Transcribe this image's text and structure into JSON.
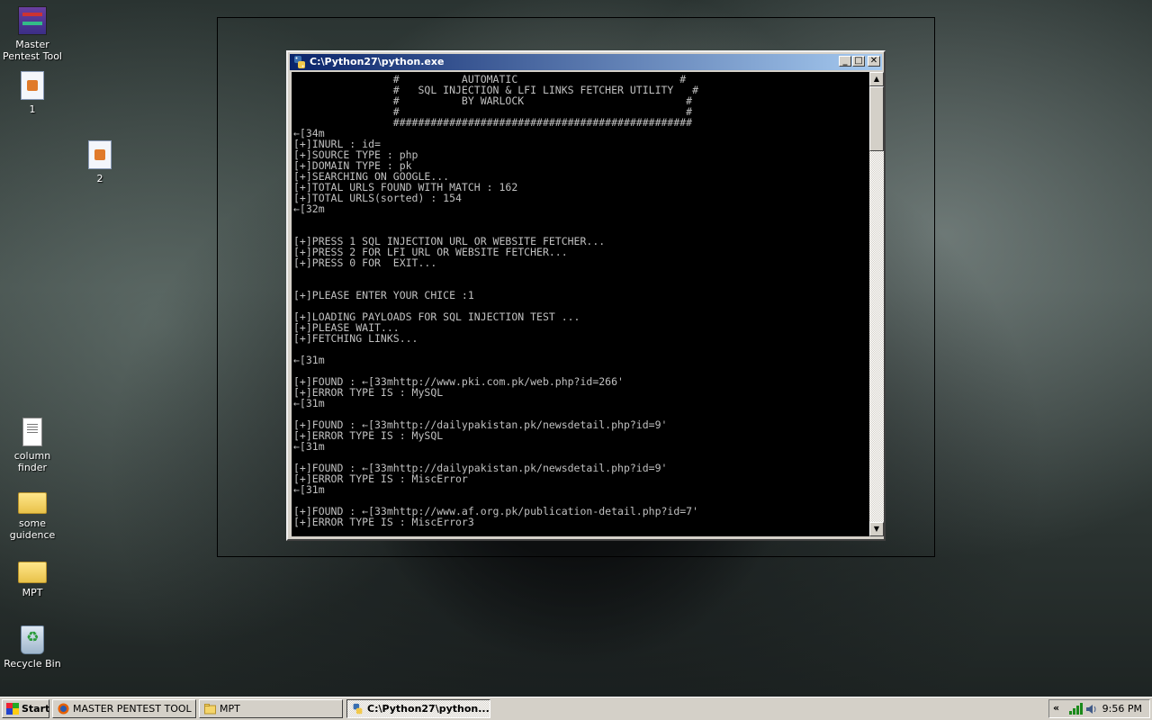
{
  "desktop": {
    "icons": [
      {
        "label": "Master Pentest Tool",
        "icon": "winrar-archive-icon"
      },
      {
        "label": "1",
        "icon": "image-file-icon"
      },
      {
        "label": "2",
        "icon": "image-file-icon"
      },
      {
        "label": "column finder",
        "icon": "text-document-icon"
      },
      {
        "label": "some guidence",
        "icon": "folder-icon"
      },
      {
        "label": "MPT",
        "icon": "folder-icon"
      },
      {
        "label": "Recycle Bin",
        "icon": "recycle-bin-icon"
      }
    ]
  },
  "window": {
    "title": "C:\\Python27\\python.exe",
    "controls": {
      "minimize": "_",
      "maximize": "□",
      "close": "✕"
    },
    "console_lines": [
      "                #          AUTOMATIC                          #",
      "                #   SQL INJECTION & LFI LINKS FETCHER UTILITY   #",
      "                #          BY WARLOCK                          #",
      "                #                                              #",
      "                ################################################",
      "←[34m",
      "[+]INURL : id=",
      "[+]SOURCE TYPE : php",
      "[+]DOMAIN TYPE : pk",
      "[+]SEARCHING ON GOOGLE...",
      "[+]TOTAL URLS FOUND WITH MATCH : 162",
      "[+]TOTAL URLS(sorted) : 154",
      "←[32m",
      "",
      "",
      "[+]PRESS 1 SQL INJECTION URL OR WEBSITE FETCHER...",
      "[+]PRESS 2 FOR LFI URL OR WEBSITE FETCHER...",
      "[+]PRESS 0 FOR  EXIT...",
      "",
      "",
      "[+]PLEASE ENTER YOUR CHICE :1",
      "",
      "[+]LOADING PAYLOADS FOR SQL INJECTION TEST ...",
      "[+]PLEASE WAIT...",
      "[+]FETCHING LINKS...",
      "",
      "←[31m",
      "",
      "[+]FOUND : ←[33mhttp://www.pki.com.pk/web.php?id=266'",
      "[+]ERROR TYPE IS : MySQL",
      "←[31m",
      "",
      "[+]FOUND : ←[33mhttp://dailypakistan.pk/newsdetail.php?id=9'",
      "[+]ERROR TYPE IS : MySQL",
      "←[31m",
      "",
      "[+]FOUND : ←[33mhttp://dailypakistan.pk/newsdetail.php?id=9'",
      "[+]ERROR TYPE IS : MiscError",
      "←[31m",
      "",
      "[+]FOUND : ←[33mhttp://www.af.org.pk/publication-detail.php?id=7'",
      "[+]ERROR TYPE IS : MiscError3",
      "_"
    ]
  },
  "taskbar": {
    "start_label": "Start",
    "tasks": [
      {
        "label": "MASTER PENTEST TOOL ...",
        "icon": "firefox-icon"
      },
      {
        "label": "MPT",
        "icon": "folder-icon"
      },
      {
        "label": "C:\\Python27\\python....",
        "icon": "python-icon"
      }
    ],
    "tray": {
      "chevron": "«",
      "clock": "9:56 PM"
    }
  }
}
